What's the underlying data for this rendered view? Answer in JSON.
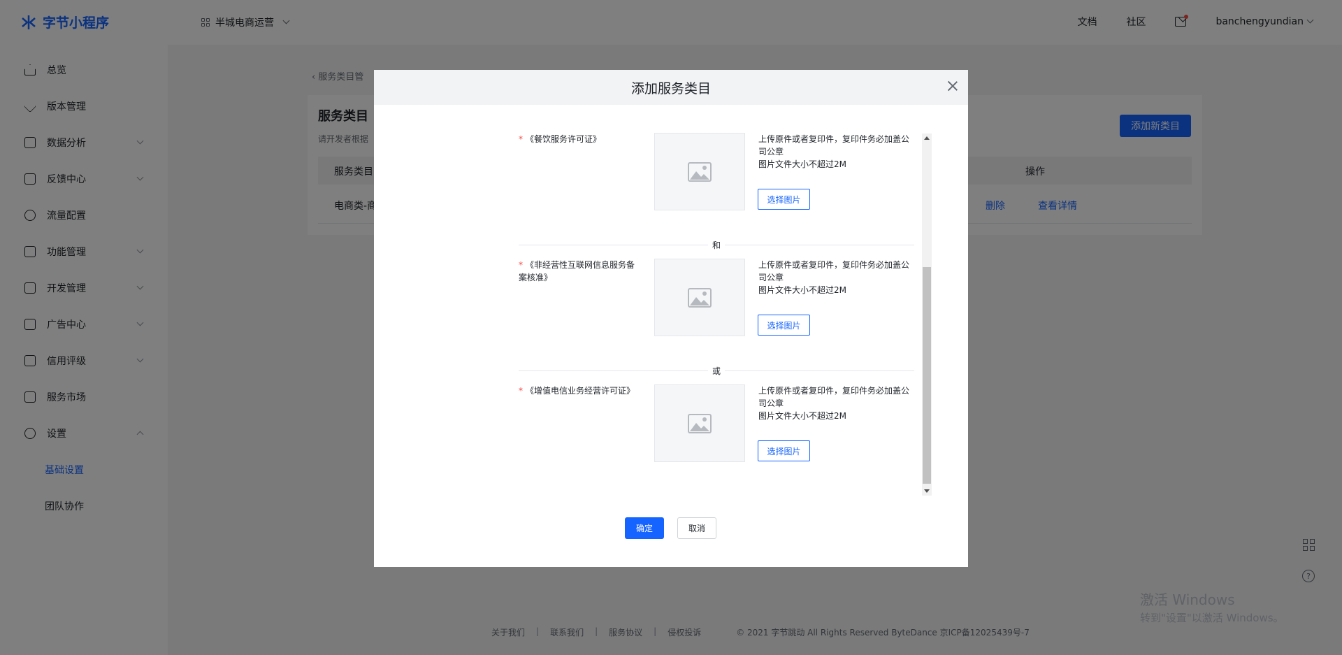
{
  "app": {
    "logo_text": "字节小程序",
    "project_name": "半城电商运营"
  },
  "header": {
    "doc_link": "文档",
    "community_link": "社区",
    "username": "banchengyundian"
  },
  "sidebar": {
    "items": [
      {
        "label": "总览"
      },
      {
        "label": "版本管理"
      },
      {
        "label": "数据分析"
      },
      {
        "label": "反馈中心"
      },
      {
        "label": "流量配置"
      },
      {
        "label": "功能管理"
      },
      {
        "label": "开发管理"
      },
      {
        "label": "广告中心"
      },
      {
        "label": "信用评级"
      },
      {
        "label": "服务市场"
      },
      {
        "label": "设置"
      }
    ],
    "sub_items": [
      {
        "label": "基础设置",
        "active": true
      },
      {
        "label": "团队协作",
        "active": false
      }
    ]
  },
  "main": {
    "breadcrumb": "服务类目管",
    "title": "服务类目",
    "description": "请开发者根据",
    "add_button": "添加新类目",
    "columns": {
      "category": "服务类目",
      "operation": "操作"
    },
    "rows": [
      {
        "category": "电商类-商",
        "delete": "删除",
        "view": "查看详情"
      }
    ]
  },
  "modal": {
    "title": "添加服务类目",
    "licenses": [
      {
        "name": "《餐饮服务许可证》",
        "hint1": "上传原件或者复印件，复印件务必加盖公司公章",
        "hint2": "图片文件大小不超过2M",
        "button": "选择图片"
      },
      {
        "name": "《非经营性互联网信息服务备案核准》",
        "hint1": "上传原件或者复印件，复印件务必加盖公司公章",
        "hint2": "图片文件大小不超过2M",
        "button": "选择图片"
      },
      {
        "name": "《增值电信业务经营许可证》",
        "hint1": "上传原件或者复印件，复印件务必加盖公司公章",
        "hint2": "图片文件大小不超过2M",
        "button": "选择图片"
      }
    ],
    "dividers": {
      "and": "和",
      "or": "或"
    },
    "confirm": "确定",
    "cancel": "取消"
  },
  "footer": {
    "links": [
      "关于我们",
      "联系我们",
      "服务协议",
      "侵权投诉"
    ],
    "copyright": "© 2021 字节跳动 All Rights Reserved ByteDance 京ICP备12025439号-7"
  },
  "windows_activation": {
    "line1": "激活 Windows",
    "line2": "转到\"设置\"以激活 Windows。"
  },
  "colors": {
    "accent": "#1664ff",
    "required": "#f54a45",
    "overlay": "rgba(0,0,0,0.5)"
  }
}
